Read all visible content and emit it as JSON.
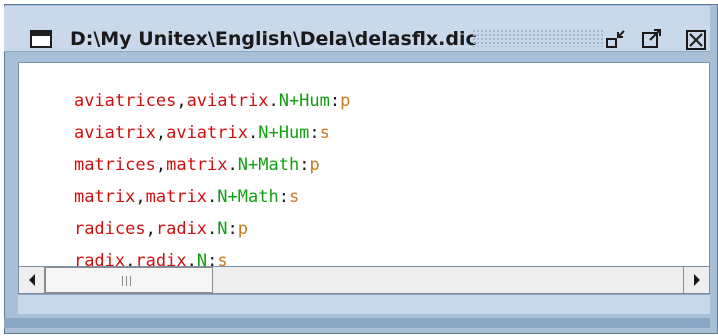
{
  "window": {
    "title": "D:\\My Unitex\\English\\Dela\\delasflx.dic",
    "buttons": {
      "minimize_icon": "minimize-icon",
      "maximize_icon": "maximize-icon",
      "close_icon": "close-icon"
    }
  },
  "colors": {
    "word": "#d01010",
    "code": "#12a012",
    "inflection": "#c8781e",
    "punct": "#1a1a1a"
  },
  "entries": [
    {
      "form": "aviatrices",
      "sep": ",",
      "lemma": "aviatrix",
      "dot": ".",
      "code": "N+Hum",
      "colon": ":",
      "infl": "p"
    },
    {
      "form": "aviatrix",
      "sep": ",",
      "lemma": "aviatrix",
      "dot": ".",
      "code": "N+Hum",
      "colon": ":",
      "infl": "s"
    },
    {
      "form": "matrices",
      "sep": ",",
      "lemma": "matrix",
      "dot": ".",
      "code": "N+Math",
      "colon": ":",
      "infl": "p"
    },
    {
      "form": "matrix",
      "sep": ",",
      "lemma": "matrix",
      "dot": ".",
      "code": "N+Math",
      "colon": ":",
      "infl": "s"
    },
    {
      "form": "radices",
      "sep": ",",
      "lemma": "radix",
      "dot": ".",
      "code": "N",
      "colon": ":",
      "infl": "p"
    },
    {
      "form": "radix",
      "sep": ",",
      "lemma": "radix",
      "dot": ".",
      "code": "N",
      "colon": ":",
      "infl": "s"
    }
  ],
  "scrollbar": {
    "left_icon": "scroll-left-arrow-icon",
    "right_icon": "scroll-right-arrow-icon",
    "thumb_icon": "scroll-thumb-grip-icon"
  }
}
